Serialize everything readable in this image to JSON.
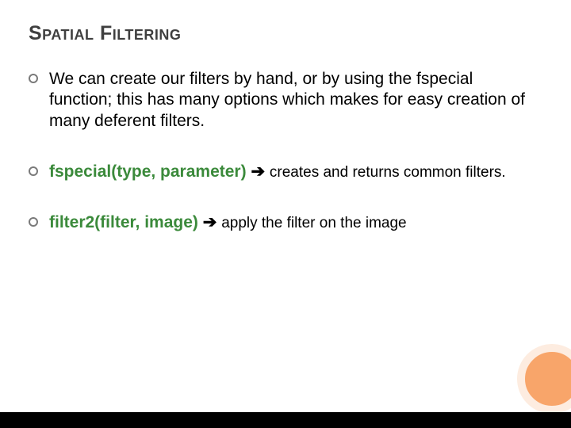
{
  "title": "Spatial Filtering",
  "bullets": [
    {
      "text": "We can create our filters by hand, or by using the fspecial function; this has many options which makes for easy creation of many deferent filters."
    },
    {
      "func": "fspecial(type, parameter)",
      "arrow": "➔",
      "desc": "creates and returns common filters."
    },
    {
      "func": "filter2(filter, image)",
      "arrow": "➔",
      "desc": "apply the filter on the image"
    }
  ]
}
